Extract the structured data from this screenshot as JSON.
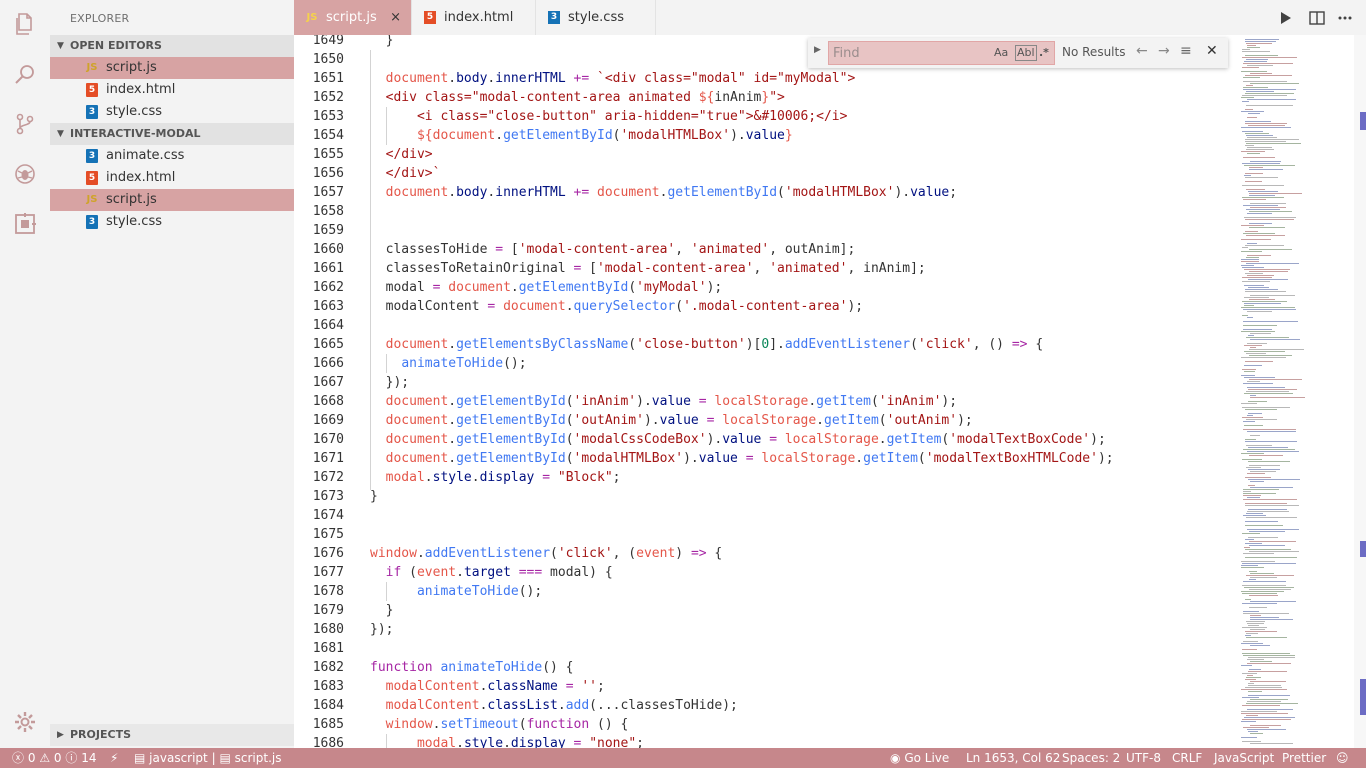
{
  "explorer": {
    "title": "EXPLORER",
    "open_editors": {
      "label": "OPEN EDITORS",
      "files": [
        {
          "name": "script.js",
          "type": "js",
          "selected": true
        },
        {
          "name": "index.html",
          "type": "html",
          "selected": false
        },
        {
          "name": "style.css",
          "type": "css",
          "selected": false
        }
      ]
    },
    "project": {
      "label": "INTERACTIVE-MODAL",
      "files": [
        {
          "name": "animate.css",
          "type": "css",
          "selected": false
        },
        {
          "name": "index.html",
          "type": "html",
          "selected": false
        },
        {
          "name": "script.js",
          "type": "js",
          "selected": true
        },
        {
          "name": "style.css",
          "type": "css",
          "selected": false
        }
      ]
    },
    "projects_label": "PROJECTS"
  },
  "tabs": [
    {
      "label": "script.js",
      "type": "js",
      "active": true,
      "close": "×"
    },
    {
      "label": "index.html",
      "type": "html",
      "active": false
    },
    {
      "label": "style.css",
      "type": "css",
      "active": false
    }
  ],
  "icons": {
    "activity": [
      "files-icon",
      "search-icon",
      "source-control-icon",
      "debug-icon",
      "extensions-icon",
      "settings-gear-icon"
    ],
    "toolbar": [
      "run-icon",
      "split-editor-icon",
      "more-icon"
    ]
  },
  "find": {
    "placeholder": "Find",
    "match_case": "Aa",
    "whole_word": "Abl",
    "regex": ".*",
    "results": "No Results"
  },
  "code_lines": [
    {
      "n": "1649",
      "html": "  }"
    },
    {
      "n": "1650",
      "html": ""
    },
    {
      "n": "1651",
      "html": "  <span class=\"var\">document</span>.<span class=\"prop\">body</span>.<span class=\"prop\">innerHTML</span> <span class=\"ar\">+=</span> <span class=\"str\">`&lt;div class=\"modal\" id=\"myModal\"&gt;</span>"
    },
    {
      "n": "1652",
      "html": "  <span class=\"str\">&lt;div class=\"modal-content-area animated </span><span class=\"var\">${</span>inAnim<span class=\"var\">}</span><span class=\"str\">\"&gt;</span>"
    },
    {
      "n": "1653",
      "html": "      <span class=\"str\">&lt;i class=\"close-button\" aria-hidden=\"true\"&gt;&amp;#10006;&lt;/i&gt;</span>"
    },
    {
      "n": "1654",
      "html": "      <span class=\"var\">${document</span>.<span class=\"mth\">getElementById</span>(<span class=\"str\">'modalHTMLBox'</span>).<span class=\"prop\">value</span><span class=\"var\">}</span>"
    },
    {
      "n": "1655",
      "html": "  <span class=\"str\">&lt;/div&gt;</span>"
    },
    {
      "n": "1656",
      "html": "  <span class=\"str\">&lt;/div&gt;`</span>"
    },
    {
      "n": "1657",
      "html": "  <span class=\"var\">document</span>.<span class=\"prop\">body</span>.<span class=\"prop\">innerHTML</span> <span class=\"ar\">+=</span> <span class=\"var\">document</span>.<span class=\"mth\">getElementById</span>(<span class=\"str\">'modalHTMLBox'</span>).<span class=\"prop\">value</span>;"
    },
    {
      "n": "1658",
      "html": ""
    },
    {
      "n": "1659",
      "html": ""
    },
    {
      "n": "1660",
      "html": "  classesToHide <span class=\"ar\">=</span> [<span class=\"str\">'modal-content-area'</span>, <span class=\"str\">'animated'</span>, outAnim];"
    },
    {
      "n": "1661",
      "html": "  classesToRetainOriginal <span class=\"ar\">=</span> [<span class=\"str\">'modal-content-area'</span>, <span class=\"str\">'animated'</span>, inAnim];"
    },
    {
      "n": "1662",
      "html": "  modal <span class=\"ar\">=</span> <span class=\"var\">document</span>.<span class=\"mth\">getElementById</span>(<span class=\"str\">'myModal'</span>);"
    },
    {
      "n": "1663",
      "html": "  modalContent <span class=\"ar\">=</span> <span class=\"var\">document</span>.<span class=\"mth\">querySelector</span>(<span class=\"str\">'.modal-content-area'</span>);"
    },
    {
      "n": "1664",
      "html": ""
    },
    {
      "n": "1665",
      "html": "  <span class=\"var\">document</span>.<span class=\"mth\">getElementsByClassName</span>(<span class=\"str\">'close-button'</span>)[<span class=\"nm\">0</span>].<span class=\"mth\">addEventListener</span>(<span class=\"str\">'click'</span>, () <span class=\"ar\">=&gt;</span> {"
    },
    {
      "n": "1666",
      "html": "    <span class=\"mth\">animateToHide</span>();"
    },
    {
      "n": "1667",
      "html": "  });"
    },
    {
      "n": "1668",
      "html": "  <span class=\"var\">document</span>.<span class=\"mth\">getElementById</span>(<span class=\"str\">'inAnim'</span>).<span class=\"prop\">value</span> <span class=\"ar\">=</span> <span class=\"var\">localStorage</span>.<span class=\"mth\">getItem</span>(<span class=\"str\">'inAnim'</span>);"
    },
    {
      "n": "1669",
      "html": "  <span class=\"var\">document</span>.<span class=\"mth\">getElementById</span>(<span class=\"str\">'outAnim'</span>).<span class=\"prop\">value</span> <span class=\"ar\">=</span> <span class=\"var\">localStorage</span>.<span class=\"mth\">getItem</span>(<span class=\"str\">'outAnim'</span>);"
    },
    {
      "n": "1670",
      "html": "  <span class=\"var\">document</span>.<span class=\"mth\">getElementById</span>(<span class=\"str\">'modalCssCodeBox'</span>).<span class=\"prop\">value</span> <span class=\"ar\">=</span> <span class=\"var\">localStorage</span>.<span class=\"mth\">getItem</span>(<span class=\"str\">'modalTextBoxCode'</span>);"
    },
    {
      "n": "1671",
      "html": "  <span class=\"var\">document</span>.<span class=\"mth\">getElementById</span>(<span class=\"str\">'modalHTMLBox'</span>).<span class=\"prop\">value</span> <span class=\"ar\">=</span> <span class=\"var\">localStorage</span>.<span class=\"mth\">getItem</span>(<span class=\"str\">'modalTextBoxHTMLCode'</span>);"
    },
    {
      "n": "1672",
      "html": "  <span class=\"var\">modal</span>.<span class=\"prop\">style</span>.<span class=\"prop\">display</span> <span class=\"ar\">=</span> <span class=\"str\">\"Block\"</span>;"
    },
    {
      "n": "1673",
      "html": "}"
    },
    {
      "n": "1674",
      "html": ""
    },
    {
      "n": "1675",
      "html": ""
    },
    {
      "n": "1676",
      "html": "<span class=\"var\">window</span>.<span class=\"mth\">addEventListener</span>(<span class=\"str\">'click'</span>, (<span class=\"var\">event</span>) <span class=\"ar\">=&gt;</span> {"
    },
    {
      "n": "1677",
      "html": "  <span class=\"ar\">if</span> (<span class=\"var\">event</span>.<span class=\"prop\">target</span> <span class=\"ar\">===</span> modal) {"
    },
    {
      "n": "1678",
      "html": "      <span class=\"mth\">animateToHide</span>();"
    },
    {
      "n": "1679",
      "html": "  }"
    },
    {
      "n": "1680",
      "html": "});"
    },
    {
      "n": "1681",
      "html": ""
    },
    {
      "n": "1682",
      "html": "<span class=\"ar\">function</span> <span class=\"mth\">animateToHide</span>() {"
    },
    {
      "n": "1683",
      "html": "  <span class=\"var\">modalContent</span>.<span class=\"prop\">className</span> <span class=\"ar\">=</span> <span class=\"str\">''</span>;"
    },
    {
      "n": "1684",
      "html": "  <span class=\"var\">modalContent</span>.<span class=\"prop\">classList</span>.<span class=\"mth\">add</span>(...classesToHide);"
    },
    {
      "n": "1685",
      "html": "  <span class=\"var\">window</span>.<span class=\"mth\">setTimeout</span>(<span class=\"ar\">function</span> () {"
    },
    {
      "n": "1686",
      "html": "      <span class=\"var\">modal</span>.<span class=\"prop\">style</span>.<span class=\"prop\">display</span> <span class=\"ar\">=</span> <span class=\"str\">\"none\"</span>;"
    }
  ],
  "status": {
    "errors": "0",
    "warnings": "0",
    "info": "14",
    "lang_path": "javascript",
    "file": "script.js",
    "go_live": "Go Live",
    "position": "Ln 1653, Col 62",
    "spaces": "Spaces: 2",
    "encoding": "UTF-8",
    "eol": "CRLF",
    "language": "JavaScript",
    "formatter": "Prettier"
  },
  "colors": {
    "accent": "#d7a3a3",
    "statusbar": "#c6878b"
  }
}
